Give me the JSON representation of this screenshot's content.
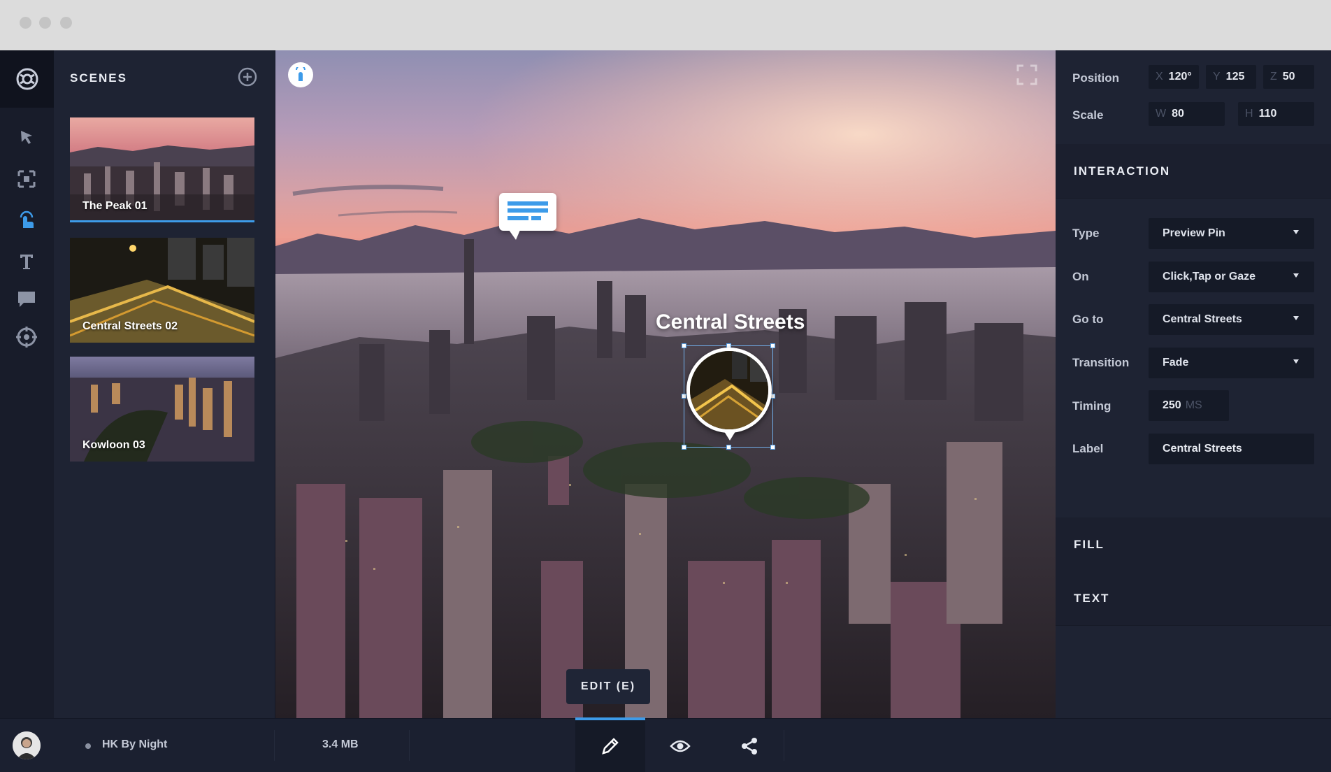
{
  "scenes": {
    "title": "SCENES",
    "items": [
      {
        "label": "The Peak 01",
        "active": true
      },
      {
        "label": "Central Streets 02",
        "active": false
      },
      {
        "label": "Kowloon 03",
        "active": false
      }
    ]
  },
  "viewport": {
    "pin_label": "Central Streets",
    "edit_button": "EDIT (E)"
  },
  "properties": {
    "position_label": "Position",
    "position": {
      "x_prefix": "X",
      "x": "120°",
      "y_prefix": "Y",
      "y": "125",
      "z_prefix": "Z",
      "z": "50"
    },
    "scale_label": "Scale",
    "scale": {
      "w_prefix": "W",
      "w": "80",
      "h_prefix": "H",
      "h": "110"
    },
    "interaction_title": "INTERACTION",
    "type_label": "Type",
    "type_value": "Preview Pin",
    "on_label": "On",
    "on_value": "Click,Tap or Gaze",
    "goto_label": "Go to",
    "goto_value": "Central Streets",
    "transition_label": "Transition",
    "transition_value": "Fade",
    "timing_label": "Timing",
    "timing_value": "250",
    "timing_unit": "MS",
    "label_label": "Label",
    "label_value": "Central Streets",
    "fill_title": "FILL",
    "text_title": "TEXT"
  },
  "status": {
    "project_name": "HK By Night",
    "file_size": "3.4 MB"
  },
  "colors": {
    "accent": "#3d9be9",
    "panel": "#1e2333",
    "field": "#151a27"
  }
}
